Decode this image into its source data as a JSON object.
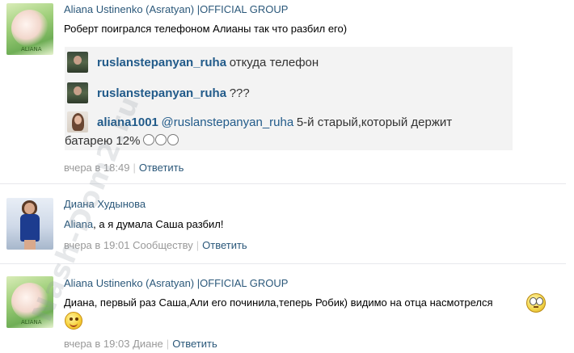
{
  "comments": [
    {
      "author": "Aliana Ustinenko (Asratyan) |OFFICIAL GROUP",
      "text": "Роберт поигрался телефоном Алианы так что разбил его)",
      "embed": {
        "rows": [
          {
            "user": "ruslanstepanyan_ruha",
            "text": "откуда телефон"
          },
          {
            "user": "ruslanstepanyan_ruha",
            "text": "???"
          },
          {
            "user": "aliana1001",
            "mention": "@ruslanstepanyan_ruha",
            "text": "5-й старый,который держит",
            "text2": "батарею 12%"
          }
        ]
      },
      "meta": {
        "time": "вчера в 18:49",
        "reply": "Ответить"
      },
      "avatar_caption": "ALIANA"
    },
    {
      "author": "Диана Худынова",
      "mention": "Aliana",
      "text": ", а я думала Саша разбил!",
      "meta": {
        "time": "вчера в 19:01",
        "community": "Сообществу",
        "reply": "Ответить"
      }
    },
    {
      "author": "Aliana Ustinenko (Asratyan) |OFFICIAL GROUP",
      "text": "Диана, первый раз Саша,Али его починила,теперь Робик) видимо на отца насмотрелся",
      "meta": {
        "time": "вчера в 19:03",
        "to": "Диане",
        "reply": "Ответить"
      },
      "avatar_caption": "ALIANA"
    }
  ],
  "watermark": "Nash-Dom2.ru",
  "colors": {
    "link": "#2b587a",
    "meta": "#999999",
    "ig_user": "#225b8a",
    "embed_bg": "#f3f3f3"
  }
}
